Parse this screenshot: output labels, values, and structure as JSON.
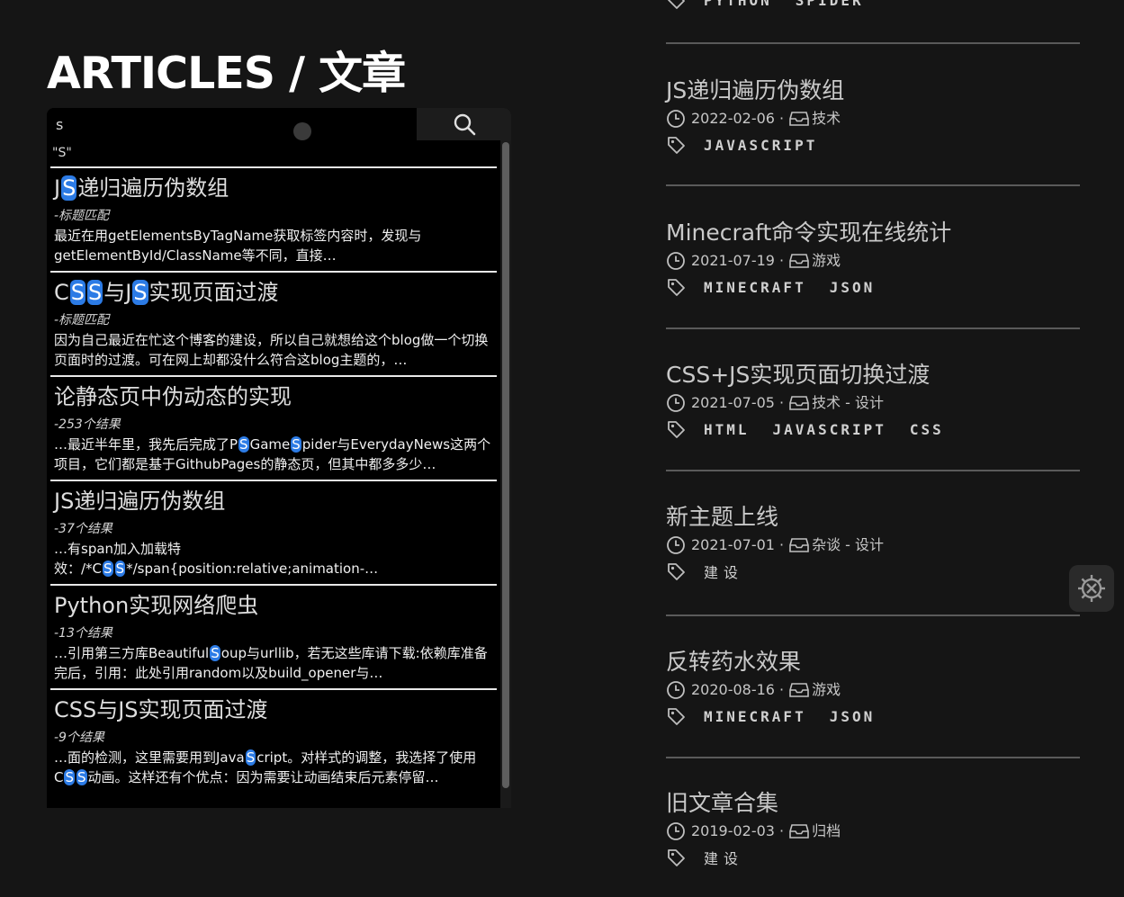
{
  "page": {
    "title": "ARTICLES / 文章"
  },
  "search": {
    "value": "s",
    "query_echo": "\"S\""
  },
  "results": [
    {
      "title_parts": [
        "J",
        "S",
        "递归遍历伪数组"
      ],
      "sub": "-标题匹配",
      "snippet_parts": [
        "最近在用getElementsByTagName获取标签内容时，发现与getElementById/ClassName等不同，直接…"
      ]
    },
    {
      "title_parts": [
        "C",
        "S",
        "S",
        "与J",
        "S",
        "实现页面过渡"
      ],
      "sub": "-标题匹配",
      "snippet_parts": [
        "因为自己最近在忙这个博客的建设，所以自己就想给这个blog做一个切换页面时的过渡。可在网上却都没什么符合这blog主题的，…"
      ]
    },
    {
      "title_parts": [
        "论静态页中伪动态的实现"
      ],
      "sub": "-253个结果",
      "snippet_parts": [
        "…最近半年里，我先后完成了P",
        "S",
        "Game",
        "S",
        "pider与EverydayNews这两个项目，它们都是基于GithubPages的静态页，但其中都多多少…"
      ]
    },
    {
      "title_parts": [
        "JS递归遍历伪数组"
      ],
      "sub": "-37个结果",
      "snippet_parts": [
        "…有span加入加载特效：/*C",
        "S",
        "S",
        "*/span{position:relative;animation-…"
      ]
    },
    {
      "title_parts": [
        "Python实现网络爬虫"
      ],
      "sub": "-13个结果",
      "snippet_parts": [
        "…引用第三方库Beautiful",
        "S",
        "oup与urllib，若无这些库请下载:依赖库准备完后，引用：此处引用random以及build_opener与…"
      ]
    },
    {
      "title_parts": [
        "CSS与JS实现页面过渡"
      ],
      "sub": "-9个结果",
      "snippet_parts": [
        "…面的检测，这里需要用到Java",
        "S",
        "cript。对样式的调整，我选择了使用C",
        "S",
        "S",
        "动画。这样还有个优点：因为需要让动画结束后元素停留…"
      ]
    }
  ],
  "top_tags": [
    "PYTHON",
    "SPIDER"
  ],
  "articles": [
    {
      "title": "JS递归遍历伪数组",
      "date": "2022-02-06",
      "category": "技术",
      "tags": [
        "JAVASCRIPT"
      ]
    },
    {
      "title": "Minecraft命令实现在线统计",
      "date": "2021-07-19",
      "category": "游戏",
      "tags": [
        "MINECRAFT",
        "JSON"
      ]
    },
    {
      "title": "CSS+JS实现页面切换过渡",
      "date": "2021-07-05",
      "category": "技术 - 设计",
      "tags": [
        "HTML",
        "JAVASCRIPT",
        "CSS"
      ]
    },
    {
      "title": "新主题上线",
      "date": "2021-07-01",
      "category": "杂谈 - 设计",
      "tags": [
        "建设"
      ]
    },
    {
      "title": "反转药水效果",
      "date": "2020-08-16",
      "category": "游戏",
      "tags": [
        "MINECRAFT",
        "JSON"
      ]
    },
    {
      "title": "旧文章合集",
      "date": "2019-02-03",
      "category": "归档",
      "tags": [
        "建设"
      ]
    }
  ],
  "colors": {
    "background": "#151515",
    "highlight": "#2c7be5",
    "panel": "#000000"
  },
  "icons": {
    "search": "search-icon",
    "clock": "clock-icon",
    "category": "inbox-icon",
    "tag": "tag-icon",
    "settings": "gear-icon"
  }
}
